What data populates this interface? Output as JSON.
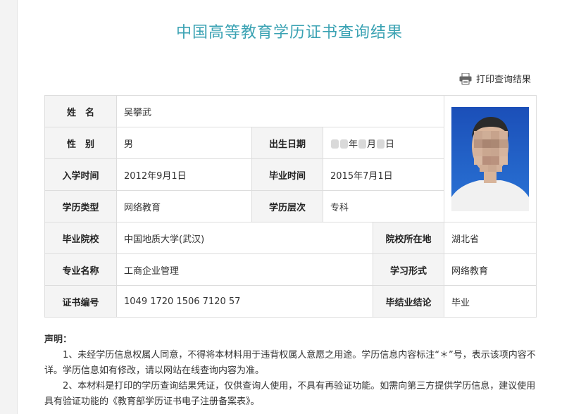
{
  "header": {
    "title": "中国高等教育学历证书查询结果",
    "print_label": "打印查询结果"
  },
  "record": {
    "name_label": "姓　名",
    "name_value": "吴攀武",
    "gender_label": "性　别",
    "gender_value": "男",
    "birth_label": "出生日期",
    "birth_value_suffix_1": "年",
    "birth_value_suffix_2": "月",
    "birth_value_suffix_3": "日",
    "enroll_label": "入学时间",
    "enroll_value": "2012年9月1日",
    "grad_label": "毕业时间",
    "grad_value": "2015年7月1日",
    "type_label": "学历类型",
    "type_value": "网络教育",
    "level_label": "学历层次",
    "level_value": "专科",
    "school_label": "毕业院校",
    "school_value": "中国地质大学(武汉)",
    "location_label": "院校所在地",
    "location_value": "湖北省",
    "major_label": "专业名称",
    "major_value": "工商企业管理",
    "study_label": "学习形式",
    "study_value": "网络教育",
    "cert_label": "证书编号",
    "cert_value": "1049 1720 1506 7120 57",
    "conclusion_label": "毕结业结论",
    "conclusion_value": "毕业"
  },
  "declaration": {
    "title": "声明：",
    "item1": "1、未经学历信息权属人同意，不得将本材料用于违背权属人意愿之用途。学历信息内容标注“＊”号，表示该项内容不详。学历信息如有修改，请以网站在线查询内容为准。",
    "item2": "2、本材料是打印的学历查询结果凭证，仅供查询人使用，不具有再验证功能。如需向第三方提供学历信息，建议使用具有验证功能的《教育部学历证书电子注册备案表》。"
  },
  "colors": {
    "title": "#3aa2b3",
    "label_bg": "#f4f4f4",
    "border": "#dddddd",
    "photo_bg": "#1f5fbf"
  }
}
